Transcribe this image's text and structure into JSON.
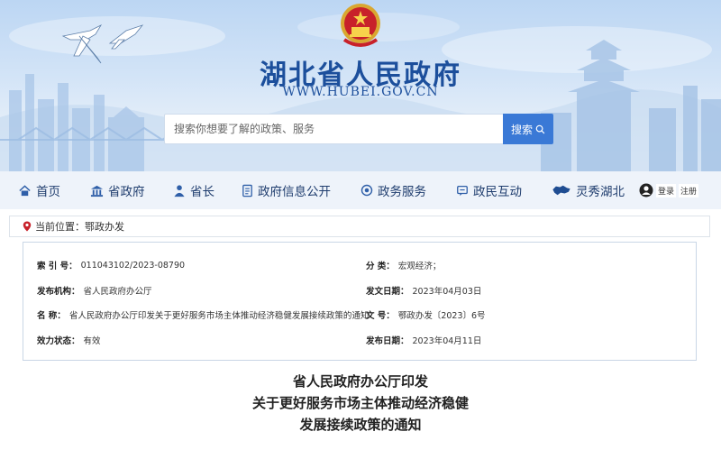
{
  "header": {
    "site_title": "湖北省人民政府",
    "site_url": "WWW.HUBEI.GOV.CN",
    "search_placeholder": "搜索你想要了解的政策、服务",
    "search_button": "搜索"
  },
  "nav": {
    "items": [
      {
        "label": "首页",
        "icon": "home-icon"
      },
      {
        "label": "省政府",
        "icon": "government-building-icon"
      },
      {
        "label": "省长",
        "icon": "governor-person-icon"
      },
      {
        "label": "政府信息公开",
        "icon": "document-info-icon"
      },
      {
        "label": "政务服务",
        "icon": "service-icon"
      },
      {
        "label": "政民互动",
        "icon": "interaction-icon"
      },
      {
        "label": "灵秀湖北",
        "icon": "hubei-map-icon"
      }
    ],
    "login": "登录",
    "register": "注册"
  },
  "breadcrumb": {
    "label": "当前位置：",
    "current": "鄂政办发"
  },
  "info": {
    "index_label": "索 引 号：",
    "index_value": "011043102/2023-08790",
    "category_label": "分    类：",
    "category_value": "宏观经济；",
    "org_label": "发布机构：",
    "org_value": "省人民政府办公厅",
    "date_label": "发文日期：",
    "date_value": "2023年04月03日",
    "name_label": "名    称：",
    "name_value": "省人民政府办公厅印发关于更好服务市场主体推动经济稳健发展接续政策的通知",
    "docno_label": "文    号：",
    "docno_value": "鄂政办发〔2023〕6号",
    "status_label": "效力状态：",
    "status_value": "有效",
    "pubdate_label": "发布日期：",
    "pubdate_value": "2023年04月11日"
  },
  "document": {
    "title_line1": "省人民政府办公厅印发",
    "title_line2": "关于更好服务市场主体推动经济稳健",
    "title_line3": "发展接续政策的通知"
  },
  "colors": {
    "brand_blue": "#1c4f9c",
    "search_button": "#3a79d6",
    "nav_background": "#eef3fa"
  }
}
